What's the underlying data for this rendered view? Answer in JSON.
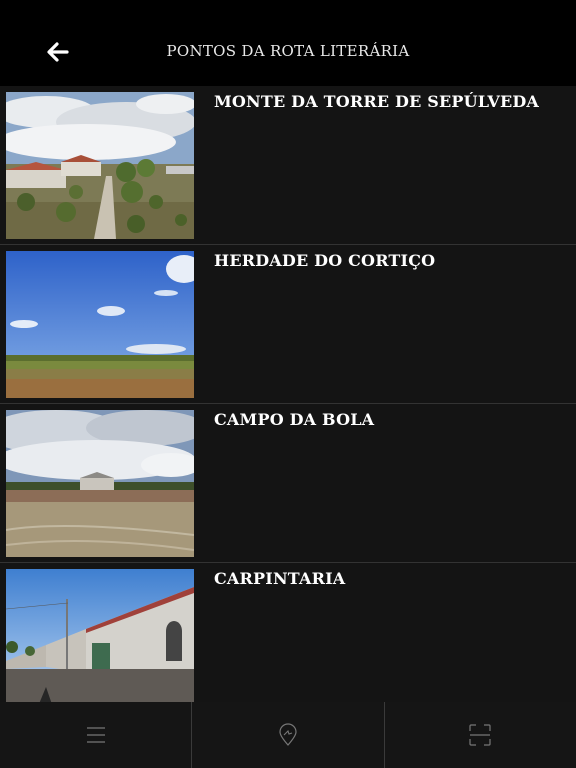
{
  "header": {
    "title": "PONTOS DA ROTA LITERÁRIA",
    "back_icon": "arrow-left-icon"
  },
  "items": [
    {
      "title": "MONTE DA TORRE DE SEPÚLVEDA",
      "image": "aerial farmhouse with olive trees and dirt road"
    },
    {
      "title": "HERDADE DO CORTIÇO",
      "image": "blue sky over open field"
    },
    {
      "title": "CAMPO DA BOLA",
      "image": "dirt football field under cloudy sky"
    },
    {
      "title": "CARPINTARIA",
      "image": "whitewashed village street with houses"
    }
  ],
  "tabbar": [
    {
      "icon": "menu-icon"
    },
    {
      "icon": "map-pin-icon"
    },
    {
      "icon": "scan-icon"
    }
  ],
  "colors": {
    "background": "#000000",
    "list_background": "#141414",
    "divider": "#333333"
  }
}
